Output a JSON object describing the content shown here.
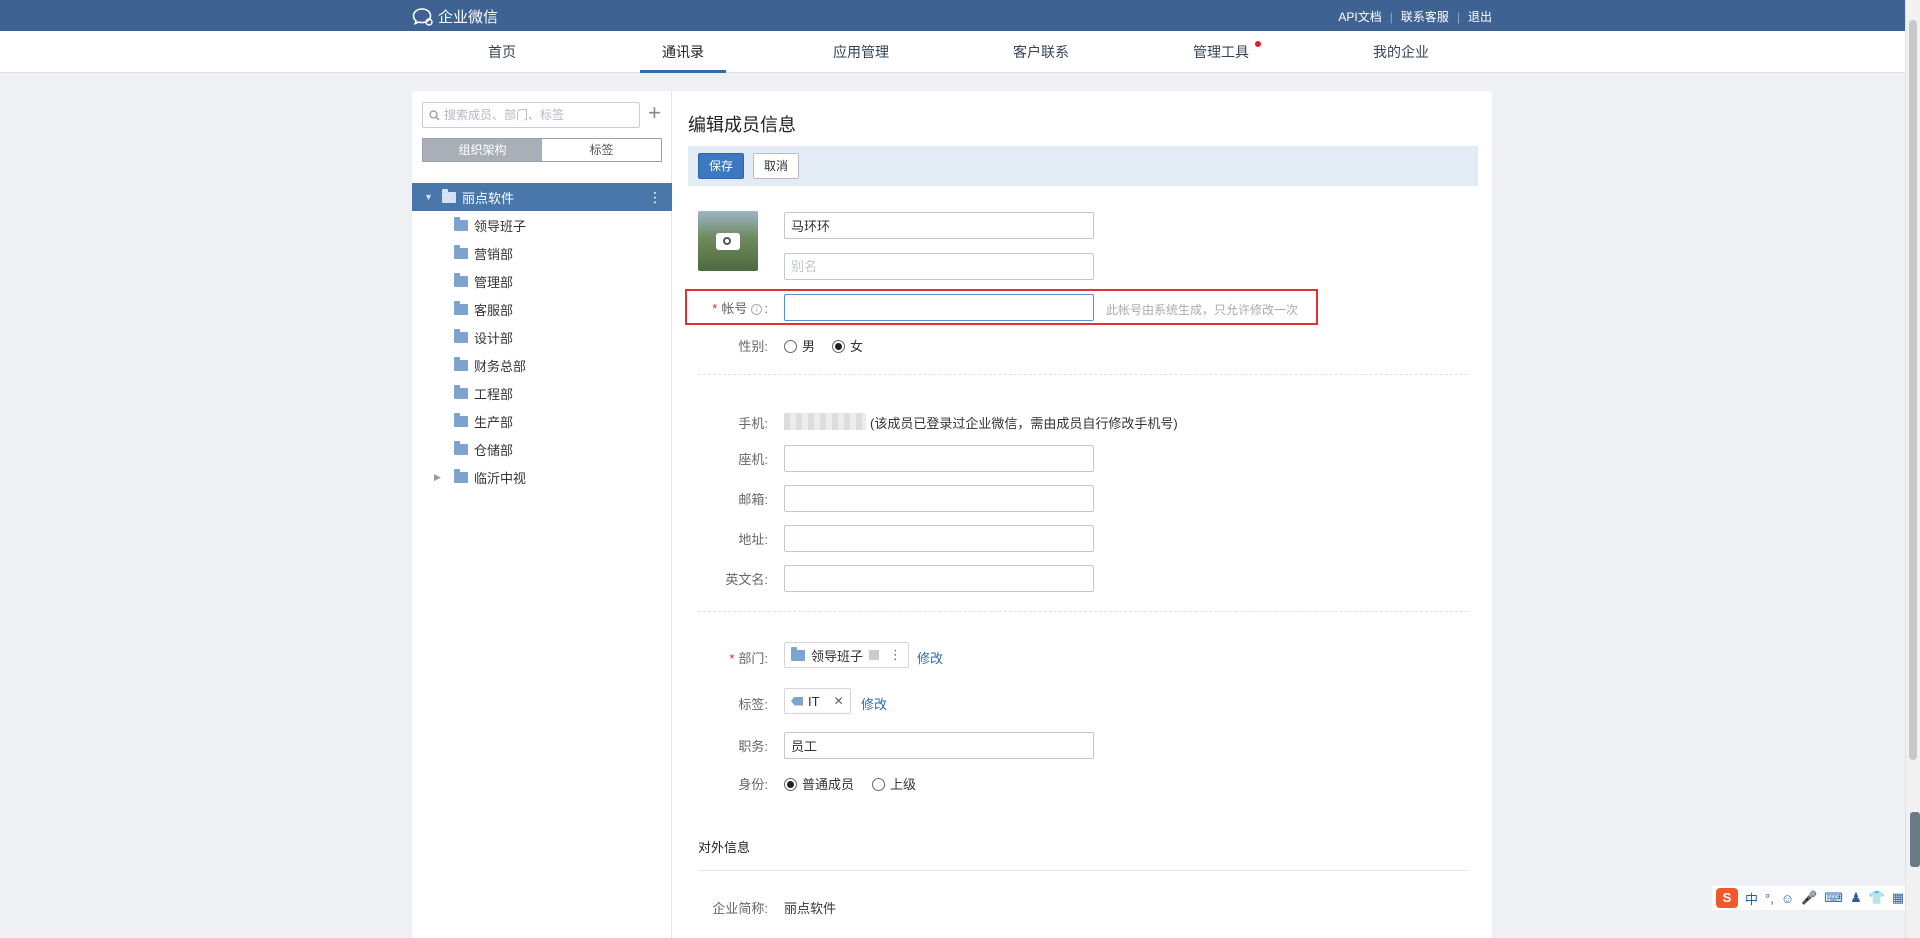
{
  "topbar": {
    "app_name": "企业微信",
    "links": [
      "API文档",
      "联系客服",
      "退出"
    ]
  },
  "nav": {
    "items": [
      "首页",
      "通讯录",
      "应用管理",
      "客户联系",
      "管理工具",
      "我的企业"
    ],
    "active": "通讯录"
  },
  "sidebar": {
    "search_placeholder": "搜索成员、部门、标签",
    "tabs": [
      "组织架构",
      "标签"
    ],
    "active_tab": "组织架构",
    "root": "丽点软件",
    "departments": [
      "领导班子",
      "营销部",
      "管理部",
      "客服部",
      "设计部",
      "财务总部",
      "工程部",
      "生产部",
      "仓储部",
      "临沂中视"
    ]
  },
  "form": {
    "title": "编辑成员信息",
    "save_label": "保存",
    "cancel_label": "取消",
    "name_value": "马环环",
    "alias_placeholder": "别名",
    "account_label": "帐号",
    "account_hint": "此帐号由系统生成，只允许修改一次",
    "gender_label": "性别:",
    "gender_male": "男",
    "gender_female": "女",
    "gender_selected": "女",
    "phone_label": "手机:",
    "phone_note": "(该成员已登录过企业微信，需由成员自行修改手机号)",
    "landline_label": "座机:",
    "email_label": "邮箱:",
    "address_label": "地址:",
    "english_name_label": "英文名:",
    "department_label": "部门:",
    "department_value": "领导班子",
    "modify_label": "修改",
    "tag_label": "标签:",
    "tag_value": "IT",
    "tag_remove": "✕",
    "position_label": "职务:",
    "position_value": "员工",
    "identity_label": "身份:",
    "identity_member": "普通成员",
    "identity_superior": "上级",
    "identity_selected": "普通成员",
    "external_title": "对外信息",
    "company_short_label": "企业简称:",
    "company_short_value": "丽点软件"
  },
  "ime": {
    "logo": "S",
    "mode": "中"
  },
  "colors": {
    "topbar": "#3e6393",
    "accent": "#2f6bad",
    "selected_row": "#4a77ab",
    "highlight_box": "#e33030"
  }
}
